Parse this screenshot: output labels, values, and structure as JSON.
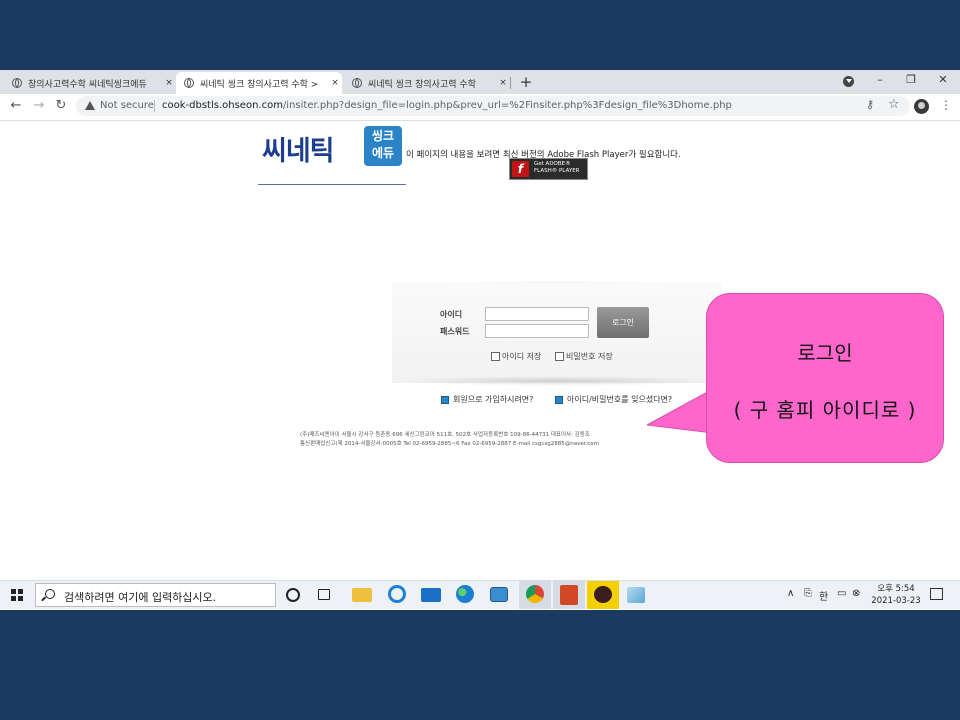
{
  "browser": {
    "tabs": [
      {
        "title": "창의사고력수학 씨네틱씽크에듀",
        "active": false
      },
      {
        "title": "씨네틱 씽크 창의사고력 수학 >",
        "active": true
      },
      {
        "title": "씨네틱 씽크 창의사고력 수학",
        "active": false
      }
    ],
    "tab_close_symbol": "×",
    "new_tab_symbol": "+",
    "window_controls": {
      "minimize": "–",
      "restore": "❐",
      "close": "✕"
    },
    "nav": {
      "back": "←",
      "forward": "→",
      "reload": "↻"
    },
    "security_label": "Not secure",
    "url_domain": "cook-dbstls.ohseon.com",
    "url_path": "/insiter.php?design_file=login.php&prev_url=%2Finsiter.php%3Fdesign_file%3Dhome.php",
    "key_symbol": "⚷",
    "star_symbol": "☆",
    "menu_symbol": "⋮"
  },
  "page": {
    "logo": {
      "main": "씨네틱",
      "box_line1": "씽크",
      "box_line2": "에듀"
    },
    "flash_notice": "이 페이지의 내용을 보려면 최신 버전의 Adobe Flash Player가 필요합니다.",
    "flash_badge": {
      "icon_letter": "f",
      "line1": "Get ADOBE®",
      "line2": "FLASH® PLAYER"
    },
    "login": {
      "id_label": "아이디",
      "password_label": "패스워드",
      "id_value": "",
      "password_value": "",
      "button_label": "로그인",
      "save_id_label": "아이디 저장",
      "save_password_label": "비밀번호 저장"
    },
    "links": {
      "signup": "회원으로 가입하시려면?",
      "forgot": "아이디/비밀번호를 잊으셨다면?"
    },
    "footer": {
      "line1": "(주)메즈씨엔아이    서울시 강서구 등촌동 696 세신그린코아 511호, 502호    사업자등록번호 109-86-44731    대표이사: 김동조",
      "line2": "통신판매업신고(제 2014-서울강서-0005호    Tel 02-6959-2885~6    Fax 02-6959-2887    E-mail  csgcsg2885@naver.com"
    }
  },
  "callout": {
    "line1": "로그인",
    "line2": "( 구 홈피 아이디로 )",
    "color": "#ff66cc"
  },
  "taskbar": {
    "search_placeholder": "검색하려면 여기에 입력하십시오.",
    "apps": [
      "cortana-icon",
      "task-view-icon",
      "file-explorer-icon",
      "ie-icon",
      "mail-icon",
      "edge-icon",
      "app-icon",
      "chrome-icon",
      "powerpoint-icon",
      "kakaotalk-icon",
      "app2-icon"
    ],
    "tray": {
      "chevron": "∧",
      "ime1": "⎘",
      "ime2": "한",
      "network": "▭",
      "volume": "⊗"
    },
    "time": "오후 5:54",
    "date": "2021-03-23"
  }
}
